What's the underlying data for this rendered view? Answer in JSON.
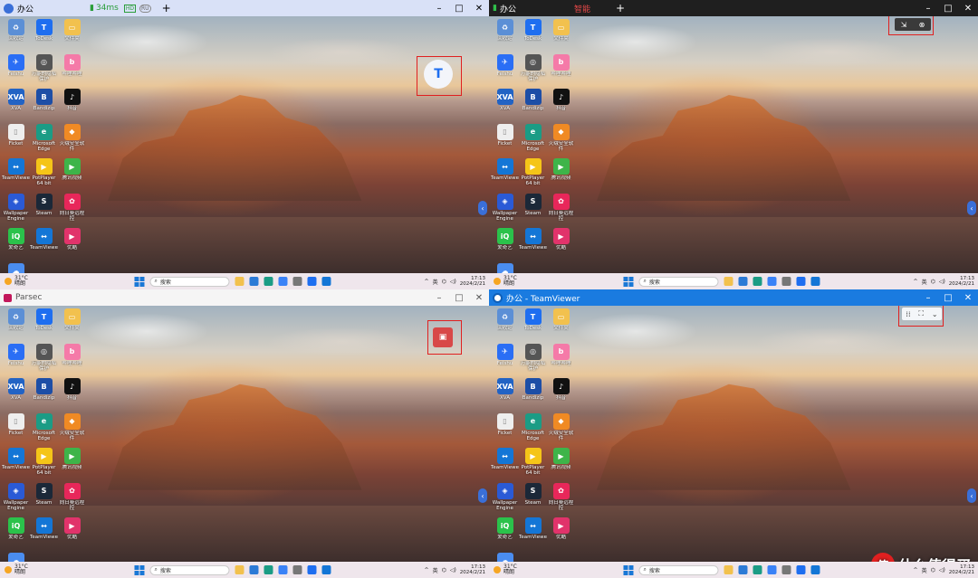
{
  "q1": {
    "tab_title": "办公",
    "ping": "34ms",
    "badge_hd": "HD",
    "badge_mode": "RU",
    "new_tab": "+",
    "ctl_min": "–",
    "ctl_max": "□",
    "ctl_close": "✕"
  },
  "q2": {
    "tab_title": "办公",
    "tag": "智能",
    "new_tab": "+",
    "ctl_min": "–",
    "ctl_max": "□",
    "ctl_close": "✕",
    "float_bar_a": "⇲",
    "float_bar_b": "⊗"
  },
  "q3": {
    "app_title": "Parsec",
    "ctl_min": "–",
    "ctl_max": "□",
    "ctl_close": "✕"
  },
  "q4": {
    "app_title": "办公 - TeamViewer",
    "ctl_min": "–",
    "ctl_max": "□",
    "ctl_close": "✕",
    "fb_drag": "⁞⁞",
    "fb_full": "⛶",
    "fb_more": "⌄"
  },
  "desktop_icons": [
    {
      "label": "回收站",
      "color": "#5b8fd6",
      "glyph": "♻"
    },
    {
      "label": "ToDesk",
      "color": "#1e6ef0",
      "glyph": "T"
    },
    {
      "label": "文件夹",
      "color": "#f2c14e",
      "glyph": "▭"
    },
    {
      "label": "Feishu",
      "color": "#2a6ef5",
      "glyph": "✈"
    },
    {
      "label": "万能的隐私保护",
      "color": "#555555",
      "glyph": "◎"
    },
    {
      "label": "哔哩哔哩",
      "color": "#f57aa8",
      "glyph": "b"
    },
    {
      "label": "XVA",
      "color": "#2263c4",
      "glyph": "XVA"
    },
    {
      "label": "Bandizip",
      "color": "#1d4ea6",
      "glyph": "B"
    },
    {
      "label": "抖音",
      "color": "#111111",
      "glyph": "♪"
    },
    {
      "label": "Ficket",
      "color": "#eeeeee",
      "glyph": "▯"
    },
    {
      "label": "Microsoft Edge",
      "color": "#1b9c85",
      "glyph": "e"
    },
    {
      "label": "火绒安全软件",
      "color": "#f08a24",
      "glyph": "◆"
    },
    {
      "label": "TeamViewer",
      "color": "#1476d6",
      "glyph": "↔"
    },
    {
      "label": "PotPlayer 64 bit",
      "color": "#f5c518",
      "glyph": "▶"
    },
    {
      "label": "腾讯视频",
      "color": "#3eb449",
      "glyph": "▶"
    },
    {
      "label": "Wallpaper Engine",
      "color": "#2a5ad6",
      "glyph": "◈"
    },
    {
      "label": "Steam",
      "color": "#1b2838",
      "glyph": "S"
    },
    {
      "label": "向日葵远程控",
      "color": "#e8275a",
      "glyph": "✿"
    },
    {
      "label": "爱奇艺",
      "color": "#2bc24b",
      "glyph": "iQ"
    },
    {
      "label": "TeamViewer",
      "color": "#1476d6",
      "glyph": "↔"
    },
    {
      "label": "优酷",
      "color": "#e1336b",
      "glyph": "▶"
    },
    {
      "label": "百度网盘",
      "color": "#4a8df0",
      "glyph": "☁"
    }
  ],
  "taskbar": {
    "weather_temp": "31°C",
    "weather_desc": "晴朗",
    "search": "搜索",
    "lang": "英",
    "clock_time": "17:13",
    "clock_date": "2024/2/21"
  },
  "taskbar_apps": [
    {
      "color": "#f2c14e"
    },
    {
      "color": "#2c7ad6"
    },
    {
      "color": "#1b9c85"
    },
    {
      "color": "#3a82f7"
    },
    {
      "color": "#777777"
    },
    {
      "color": "#1e6ef0"
    },
    {
      "color": "#1476d6"
    }
  ],
  "side_arrow": "‹",
  "watermark": "什么值得买",
  "watermark_badge": "值"
}
